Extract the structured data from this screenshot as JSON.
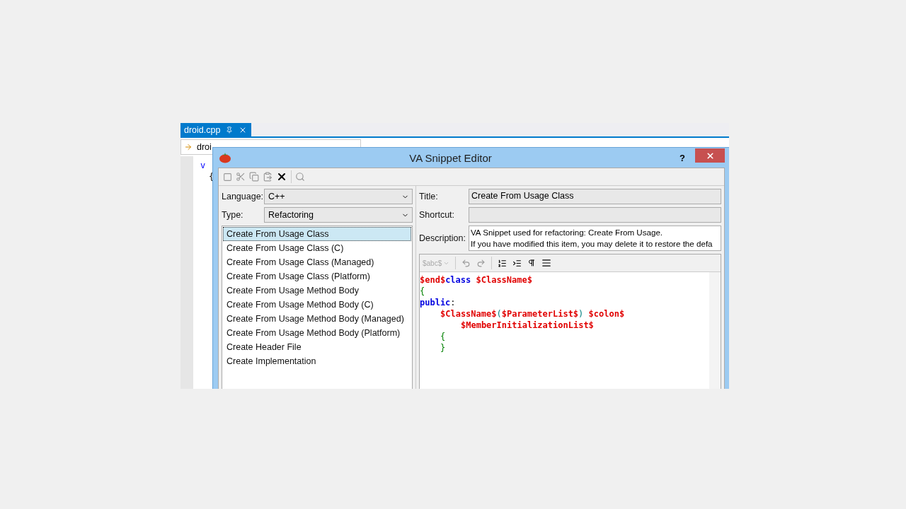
{
  "editor_tab": {
    "label": "droid.cpp"
  },
  "navigation_bar": {
    "file": "droi"
  },
  "editor_fragments": [
    "v",
    "{"
  ],
  "dialog": {
    "title": "VA Snippet Editor",
    "help": "?",
    "language": {
      "label": "Language:",
      "value": "C++"
    },
    "type": {
      "label": "Type:",
      "value": "Refactoring"
    },
    "snippets": [
      {
        "label": "Create From Usage Class",
        "selected": true
      },
      {
        "label": "Create From Usage Class (C)",
        "selected": false
      },
      {
        "label": "Create From Usage Class (Managed)",
        "selected": false
      },
      {
        "label": "Create From Usage Class (Platform)",
        "selected": false
      },
      {
        "label": "Create From Usage Method Body",
        "selected": false
      },
      {
        "label": "Create From Usage Method Body (C)",
        "selected": false
      },
      {
        "label": "Create From Usage Method Body (Managed)",
        "selected": false
      },
      {
        "label": "Create From Usage Method Body (Platform)",
        "selected": false
      },
      {
        "label": "Create Header File",
        "selected": false
      },
      {
        "label": "Create Implementation",
        "selected": false
      }
    ],
    "title_field": {
      "label": "Title:",
      "value": "Create From Usage Class"
    },
    "shortcut_field": {
      "label": "Shortcut:"
    },
    "description_field": {
      "label": "Description:",
      "lines": [
        "VA Snippet used for refactoring: Create From Usage.",
        "If you have modified this item, you may delete it to restore the defa"
      ]
    },
    "code_toolbar": {
      "variable_menu": "$abc$"
    },
    "code": [
      {
        "kind": "flush",
        "segments": [
          {
            "kind": "var",
            "text": "$end$"
          },
          {
            "kind": "keyword",
            "text": "class "
          },
          {
            "kind": "var",
            "text": "$ClassName$"
          }
        ]
      },
      {
        "kind": "flush",
        "segments": [
          {
            "kind": "brace",
            "text": "{"
          }
        ]
      },
      {
        "kind": "flush",
        "segments": [
          {
            "kind": "keyword",
            "text": "public"
          },
          {
            "kind": "plain",
            "text": ":"
          }
        ]
      },
      {
        "kind": "indented",
        "segments": [
          {
            "kind": "var",
            "text": "$ClassName$"
          },
          {
            "kind": "paren",
            "text": "("
          },
          {
            "kind": "var",
            "text": "$ParameterList$"
          },
          {
            "kind": "paren",
            "text": ") "
          },
          {
            "kind": "var",
            "text": "$colon$"
          }
        ]
      },
      {
        "kind": "nested",
        "segments": [
          {
            "kind": "var",
            "text": "$MemberInitializationList$"
          }
        ]
      },
      {
        "kind": "indented",
        "segments": [
          {
            "kind": "brace",
            "text": "{"
          }
        ]
      },
      {
        "kind": "indented",
        "segments": [
          {
            "kind": "brace",
            "text": "}"
          }
        ]
      }
    ]
  }
}
